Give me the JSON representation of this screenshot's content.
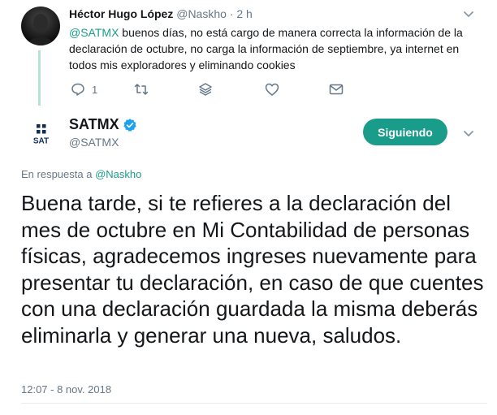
{
  "reply": {
    "name": "Héctor Hugo López",
    "handle": "@Naskho",
    "separator": "·",
    "time": "2 h",
    "mention": "@SATMX",
    "text": " buenos días, no está cargo de manera correcta la información de la declaración de octubre, no carga la información de septiembre, ya internet en todos mis exploradores y eliminando cookies",
    "reply_count": "1",
    "icons": [
      "reply-icon",
      "retweet-icon",
      "stack-icon",
      "like-icon",
      "message-icon"
    ]
  },
  "main": {
    "name": "SATMX",
    "handle": "@SATMX",
    "avatar_label": "SAT",
    "follow_label": "Siguiendo",
    "replying_prefix": "En respuesta a ",
    "replying_handle": "@Naskho",
    "text": "Buena tarde, si te refieres a la declaración del mes de octubre en Mi Contabilidad de personas físicas, agradecemos ingreses nuevamente para presentar tu declaración, en caso de que cuentes con una declaración guardada la misma deberás eliminarla y generar una nueva, saludos.",
    "timestamp": "12:07 - 8 nov. 2018"
  },
  "colors": {
    "accent": "#1a9c8a",
    "verified": "#1da1f2",
    "muted": "#657786",
    "sat_navy": "#0d2d52"
  }
}
